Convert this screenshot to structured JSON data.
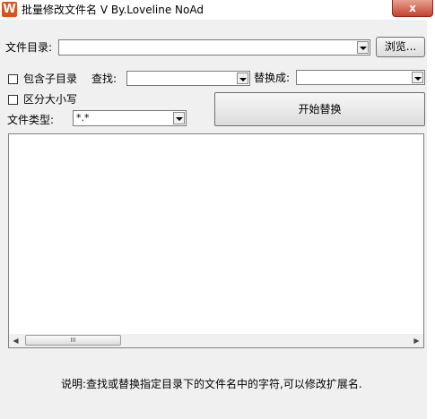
{
  "window": {
    "title": "批量修改文件名 V   By.Loveline  NoAd",
    "icon_letter": "W",
    "close_label": "x"
  },
  "form": {
    "dir_label": "文件目录:",
    "dir_value": "",
    "browse_label": "浏览...",
    "include_sub_label": "包含子目录",
    "include_sub_checked": false,
    "find_label": "查找:",
    "find_value": "",
    "replace_label": "替换成:",
    "replace_value": "",
    "case_label": "区分大小写",
    "case_checked": false,
    "type_label": "文件类型:",
    "type_value": "*.*",
    "start_label": "开始替换"
  },
  "list": {
    "items": [],
    "scroll_thumb_glyph": "III"
  },
  "footer": {
    "description": "说明:查找或替换指定目录下的文件名中的字符,可以修改扩展名."
  },
  "colors": {
    "accent_icon": "#d9531e",
    "close": "#c4442f"
  }
}
